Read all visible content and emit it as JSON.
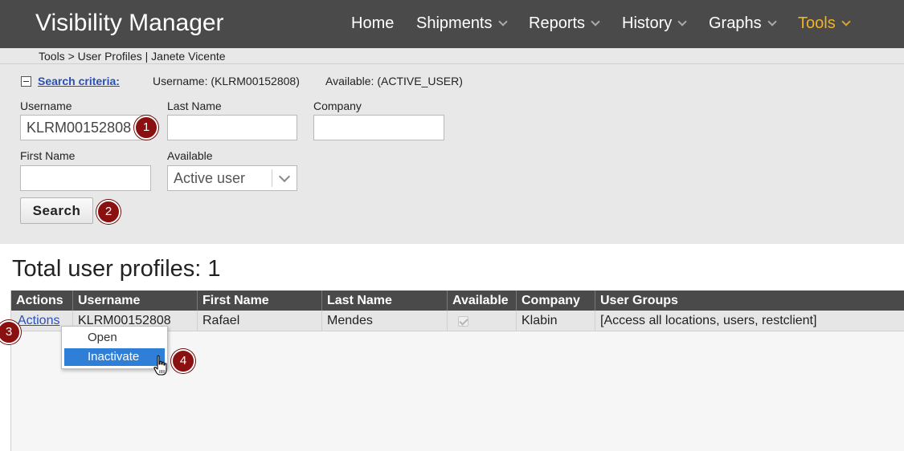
{
  "header": {
    "app_title": "Visibility Manager",
    "nav": [
      {
        "label": "Home",
        "dropdown": false
      },
      {
        "label": "Shipments",
        "dropdown": true
      },
      {
        "label": "Reports",
        "dropdown": true
      },
      {
        "label": "History",
        "dropdown": true
      },
      {
        "label": "Graphs",
        "dropdown": true
      },
      {
        "label": "Tools",
        "dropdown": true,
        "active": true
      }
    ],
    "active_color": "#f0b323"
  },
  "breadcrumb": "Tools > User Profiles | Janete Vicente",
  "search": {
    "criteria_link": "Search criteria:",
    "summary_username": "Username: (KLRM00152808)",
    "summary_available": "Available: (ACTIVE_USER)",
    "fields": {
      "username": {
        "label": "Username",
        "value": "KLRM00152808"
      },
      "last_name": {
        "label": "Last Name",
        "value": ""
      },
      "company": {
        "label": "Company",
        "value": ""
      },
      "first_name": {
        "label": "First Name",
        "value": ""
      },
      "available": {
        "label": "Available",
        "value": "Active user"
      }
    },
    "search_button": "Search"
  },
  "results": {
    "total_label": "Total user profiles: 1",
    "columns": [
      "Actions",
      "Username",
      "First Name",
      "Last Name",
      "Available",
      "Company",
      "User Groups"
    ],
    "rows": [
      {
        "actions": "Actions",
        "username": "KLRM00152808",
        "first_name": "Rafael",
        "last_name": "Mendes",
        "available": true,
        "company": "Klabin",
        "user_groups": "[Access all locations, users, restclient]"
      }
    ]
  },
  "context_menu": {
    "items": [
      "Open",
      "Inactivate"
    ],
    "highlighted": "Inactivate",
    "highlight_color": "#2f7fd8"
  },
  "markers": [
    "1",
    "2",
    "3",
    "4"
  ],
  "marker_color": "#8b1010"
}
